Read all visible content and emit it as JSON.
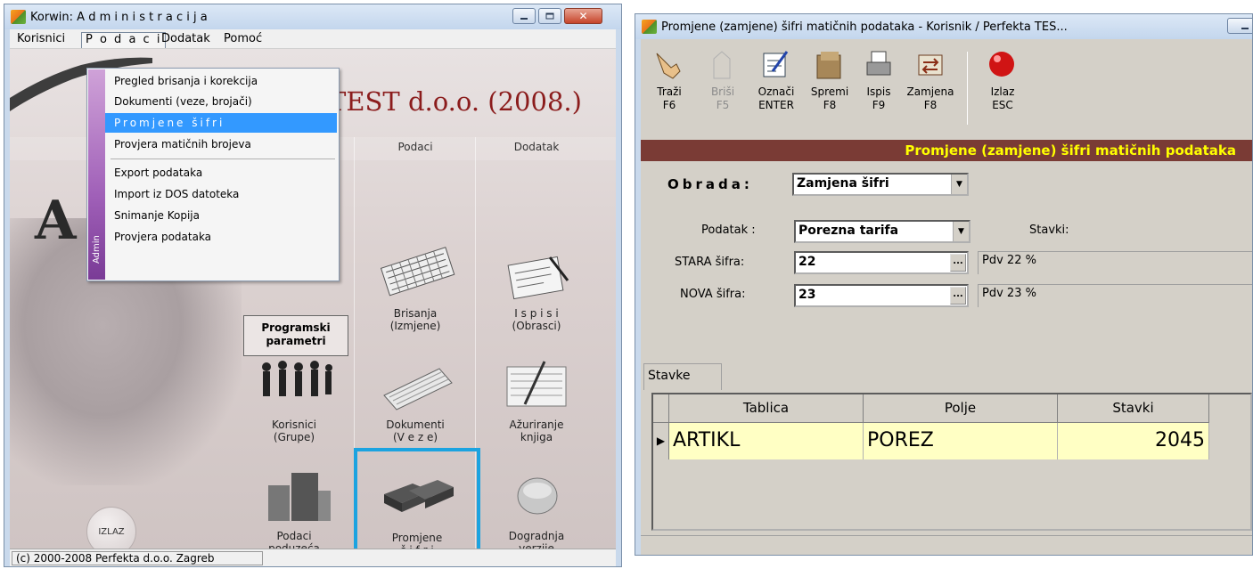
{
  "window1": {
    "title": "Korwin: A d m i n i s t r a c i j a",
    "menu": [
      "Korisnici",
      "P o d a c i",
      "Dodatak",
      "Pomoć"
    ],
    "company": "TEST d.o.o. (2008.)",
    "columns": [
      "Podaci",
      "Dodatak"
    ],
    "big_letter": "A",
    "dropdown": {
      "side_label": "Admin",
      "items": [
        "Pregled brisanja i korekcija",
        "Dokumenti (veze, brojači)",
        "Promjene šifri",
        "Provjera matičnih brojeva",
        "Export podataka",
        "Import iz DOS datoteka",
        "Snimanje Kopija",
        "Provjera podataka"
      ]
    },
    "tiles": {
      "programski": "Programski\nparametri",
      "brisanja": "Brisanja\n(Izmjene)",
      "ispisi": "I s p i s i\n(Obrasci)",
      "korisnici": "Korisnici\n(Grupe)",
      "dokumenti": "Dokumenti\n(V e z e)",
      "azuriranje": "Ažuriranje\nknjiga",
      "podaci_poduzeca": "Podaci\npoduzeća",
      "promjene": "Promjene\nš i f r i",
      "dogradnja": "Dogradnja\nverzije"
    },
    "izlaz": "IZLAZ",
    "status": "(c) 2000-2008 Perfekta d.o.o. Zagreb"
  },
  "window2": {
    "title": "Promjene (zamjene) šifri matičnih podataka - Korisnik / Perfekta TES...",
    "toolbar": [
      {
        "label": "Traži\nF6"
      },
      {
        "label": "Briši\nF5"
      },
      {
        "label": "Označi\nENTER"
      },
      {
        "label": "Spremi\nF8"
      },
      {
        "label": "Ispis\nF9"
      },
      {
        "label": "Zamjena\nF8"
      },
      {
        "label": "Izlaz\nESC"
      }
    ],
    "form_title": "Promjene (zamjene) šifri matičnih podataka",
    "obrada_label": "Obrada:",
    "obrada_value": "Zamjena šifri",
    "podatak_label": "Podatak :",
    "podatak_value": "Porezna tarifa",
    "stavki_label": "Stavki:",
    "stara_label": "STARA šifra:",
    "stara_value": "22",
    "stara_desc": "Pdv 22 %",
    "nova_label": "NOVA šifra:",
    "nova_value": "23",
    "nova_desc": "Pdv 23 %",
    "tab": "Stavke",
    "grid": {
      "headers": [
        "Tablica",
        "Polje",
        "Stavki"
      ],
      "rows": [
        [
          "ARTIKL",
          "POREZ",
          "2045"
        ]
      ]
    }
  },
  "colors": {
    "highlight": "#3399ff",
    "selection_border": "#1ba3e0",
    "form_title_bg": "#7a3b35",
    "form_title_fg": "#ffff00",
    "grid_row_bg": "#ffffc4"
  }
}
